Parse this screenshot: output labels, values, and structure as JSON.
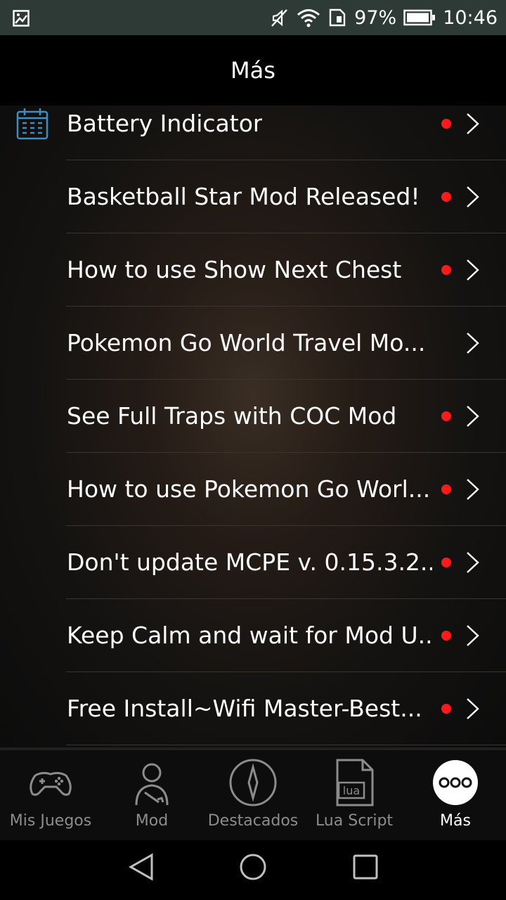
{
  "status_bar": {
    "battery_percent": "97%",
    "time": "10:46",
    "icons": [
      "gallery-icon",
      "mute-icon",
      "wifi-icon",
      "sim-icon",
      "battery-icon"
    ]
  },
  "header": {
    "title": "Más"
  },
  "list": {
    "items": [
      {
        "label": "Battery Indicator",
        "unread": true
      },
      {
        "label": "Basketball Star Mod Released!",
        "unread": true
      },
      {
        "label": "How to use Show Next Chest",
        "unread": true
      },
      {
        "label": "Pokemon Go World Travel Mo...",
        "unread": false
      },
      {
        "label": "See Full Traps with COC Mod",
        "unread": true
      },
      {
        "label": "How to use Pokemon Go Worl...",
        "unread": true
      },
      {
        "label": "Don't update MCPE v. 0.15.3.2...",
        "unread": true
      },
      {
        "label": "Keep Calm and wait for Mod U...",
        "unread": true
      },
      {
        "label": "Free Install~Wifi Master-Best...",
        "unread": true
      }
    ]
  },
  "tabs": [
    {
      "label": "Mis Juegos",
      "icon": "gamepad-icon",
      "active": false
    },
    {
      "label": "Mod",
      "icon": "person-wrench-icon",
      "active": false
    },
    {
      "label": "Destacados",
      "icon": "compass-icon",
      "active": false
    },
    {
      "label": "Lua Script",
      "icon": "lua-file-icon",
      "icon_text": "lua",
      "active": false
    },
    {
      "label": "Más",
      "icon": "more-icon",
      "active": true
    }
  ],
  "colors": {
    "unread_dot": "#ff1a1a",
    "status_bar": "#2e3a36"
  }
}
